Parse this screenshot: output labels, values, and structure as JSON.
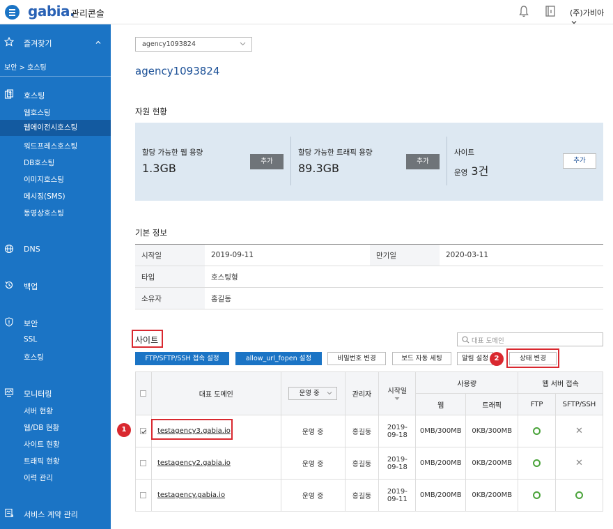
{
  "header": {
    "logo": "gabia.",
    "console_label": "관리콘솔",
    "user": "(주)가비아",
    "icons": [
      "menu-icon",
      "bell-icon",
      "book-icon",
      "chevron-down-icon"
    ]
  },
  "sidebar": {
    "favorites": "즐겨찾기",
    "breadcrumb": "보안 > 호스팅",
    "hosting": "호스팅",
    "hosting_items": [
      "웹호스팅",
      "웹에이전시호스팅",
      "워드프레스호스팅",
      "DB호스팅",
      "이미지호스팅",
      "메시징(SMS)",
      "동영상호스팅"
    ],
    "active_item": "웹에이전시호스팅",
    "dns": "DNS",
    "backup": "백업",
    "security": "보안",
    "security_items": [
      "SSL",
      "호스팅"
    ],
    "monitoring": "모니터링",
    "monitoring_items": [
      "서버 현황",
      "웹/DB 현황",
      "사이트 현황",
      "트래픽 현황",
      "이력 관리"
    ],
    "contract": "서비스 계약 관리"
  },
  "main": {
    "account_select": "agency1093824",
    "account_title": "agency1093824",
    "resources_title": "자원 현황",
    "resources": [
      {
        "label": "할당 가능한 웹 용량",
        "value": "1.3GB",
        "button": "추가"
      },
      {
        "label": "할당 가능한 트래픽 용량",
        "value": "89.3GB",
        "button": "추가"
      },
      {
        "label": "사이트",
        "value_prefix": "운영",
        "value": "3건",
        "button": "추가"
      }
    ],
    "basic_title": "기본 정보",
    "basic": {
      "start_label": "시작일",
      "start": "2019-09-11",
      "end_label": "만기일",
      "end": "2020-03-11",
      "type_label": "타입",
      "type": "호스팅형",
      "owner_label": "소유자",
      "owner": "홍길동"
    },
    "site_title": "사이트",
    "search_placeholder": "대표 도메인",
    "buttons": {
      "ftp": "FTP/SFTP/SSH 접속 설정",
      "allow_url": "allow_url_fopen 설정",
      "password": "비밀번호 변경",
      "board": "보드 자동 세팅",
      "notify": "알림 설정",
      "status": "상태 변경"
    },
    "badges": [
      "1",
      "2"
    ],
    "table": {
      "headers": {
        "domain": "대표 도메인",
        "status_filter": "운영 중",
        "manager": "관리자",
        "start": "시작일",
        "usage": "사용량",
        "web": "웹",
        "traffic": "트래픽",
        "web_server": "웹 서버 접속",
        "ftp": "FTP",
        "sftp": "SFTP/SSH"
      },
      "rows": [
        {
          "checked": true,
          "domain": "testagency3.gabia.io",
          "status": "운영 중",
          "manager": "홍길동",
          "date1": "2019-",
          "date2": "09-18",
          "web": "0MB/300MB",
          "traffic": "0KB/300MB",
          "ftp": "on",
          "sftp": "off"
        },
        {
          "checked": false,
          "domain": "testagency2.gabia.io",
          "status": "운영 중",
          "manager": "홍길동",
          "date1": "2019-",
          "date2": "09-18",
          "web": "0MB/200MB",
          "traffic": "0KB/200MB",
          "ftp": "on",
          "sftp": "off"
        },
        {
          "checked": false,
          "domain": "testagency.gabia.io",
          "status": "운영 중",
          "manager": "홍길동",
          "date1": "2019-",
          "date2": "09-11",
          "web": "0MB/200MB",
          "traffic": "0KB/200MB",
          "ftp": "on",
          "sftp": "on"
        }
      ]
    }
  },
  "colors": {
    "brand_blue": "#1b74c5",
    "highlight_red": "#d9282f",
    "ok_green": "#4aa33a"
  }
}
